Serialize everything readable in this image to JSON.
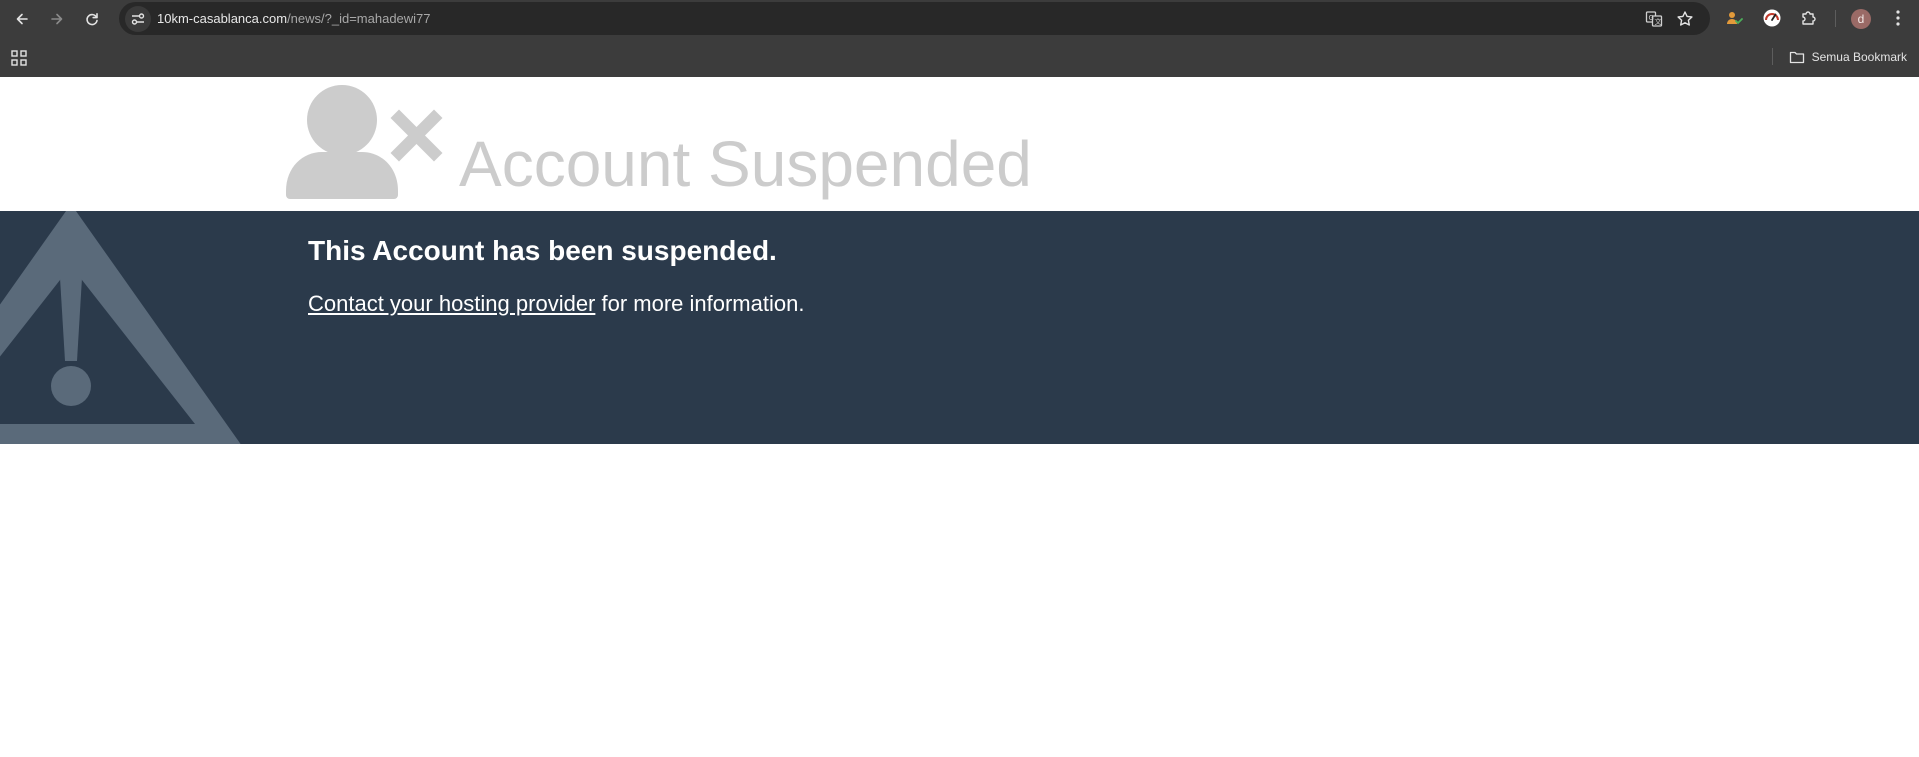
{
  "browser": {
    "url_host": "10km-casablanca.com",
    "url_path": "/news/?_id=mahadewi77",
    "profile_initial": "d",
    "bookmarks_folder_label": "Semua Bookmark"
  },
  "icons": {
    "back": "back-arrow-icon",
    "forward": "forward-arrow-icon",
    "reload": "reload-icon",
    "site_info": "site-info-icon",
    "translate": "translate-icon",
    "bookmark_star": "star-icon",
    "extension_1": "person-check-icon",
    "extension_2": "gauge-icon",
    "extensions": "puzzle-icon",
    "menu": "kebab-menu-icon",
    "apps": "apps-grid-icon",
    "folder": "folder-icon",
    "suspended_user": "user-x-icon",
    "warning": "warning-triangle-icon"
  },
  "page": {
    "title": "Account Suspended",
    "heading": "This Account has been suspended.",
    "link_text": "Contact your hosting provider",
    "trailing_text": " for more information."
  },
  "colors": {
    "banner_bg": "#2b3a4b",
    "title_gray": "#cccccc",
    "warning_gray": "#5a6a7a"
  }
}
